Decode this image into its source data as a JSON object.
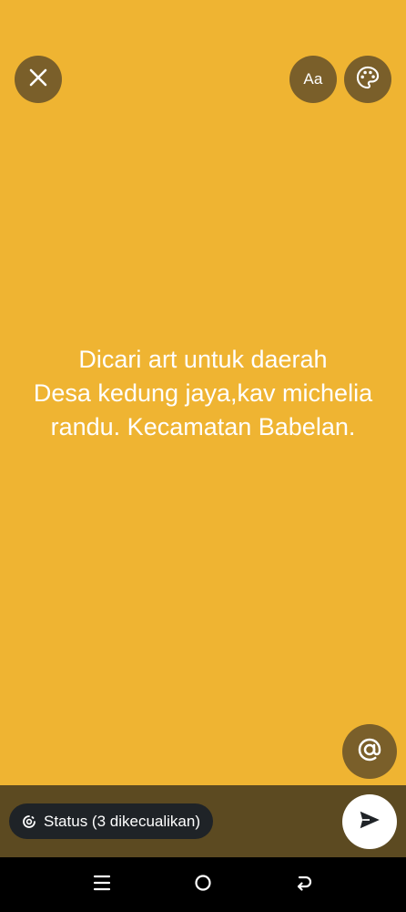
{
  "editor": {
    "background_color": "#EFB432",
    "status_text": "Dicari art untuk daerah\nDesa kedung jaya,kav michelia\nrandu. Kecamatan Babelan.",
    "text_color": "#FFFFFF"
  },
  "toolbar": {
    "close_icon": "close-icon",
    "font_button_label": "Aa",
    "palette_icon": "palette-icon"
  },
  "mention": {
    "icon": "at-sign-icon"
  },
  "bottom_bar": {
    "privacy_icon": "status-privacy-icon",
    "privacy_label": "Status (3 dikecualikan)",
    "send_icon": "send-icon"
  },
  "nav": {
    "items": [
      "recents-icon",
      "home-icon",
      "back-icon"
    ]
  }
}
